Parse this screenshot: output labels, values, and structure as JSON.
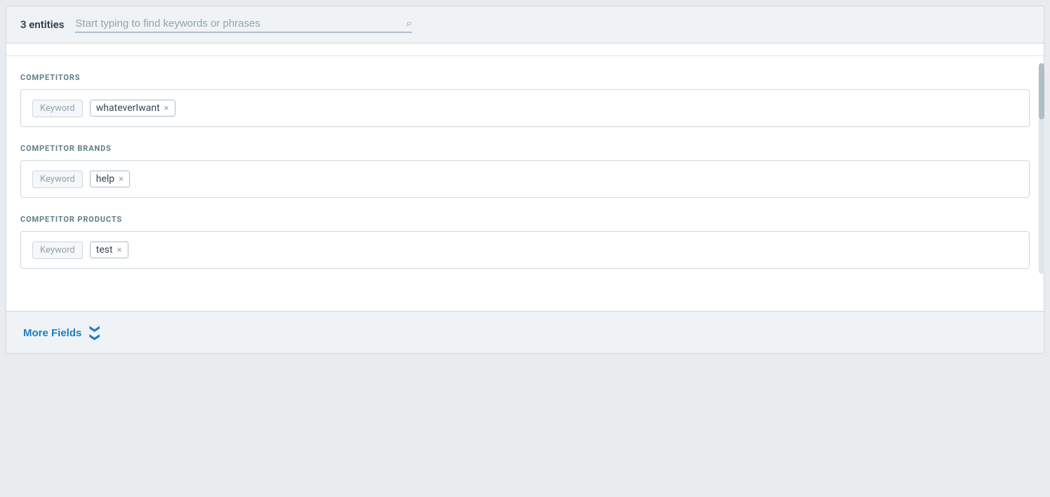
{
  "header": {
    "entities_count": "3 entities",
    "search_placeholder": "Start typing to find keywords or phrases"
  },
  "sections": [
    {
      "id": "competitors",
      "title": "COMPETITORS",
      "keyword_label": "Keyword",
      "tags": [
        {
          "text": "whateverIwant"
        }
      ]
    },
    {
      "id": "competitor-brands",
      "title": "COMPETITOR BRANDS",
      "keyword_label": "Keyword",
      "tags": [
        {
          "text": "help"
        }
      ]
    },
    {
      "id": "competitor-products",
      "title": "COMPETITOR PRODUCTS",
      "keyword_label": "Keyword",
      "tags": [
        {
          "text": "test"
        }
      ]
    }
  ],
  "footer": {
    "more_fields_label": "More Fields"
  },
  "icons": {
    "search": "🔍",
    "close": "×",
    "chevron_down": "⌄"
  }
}
